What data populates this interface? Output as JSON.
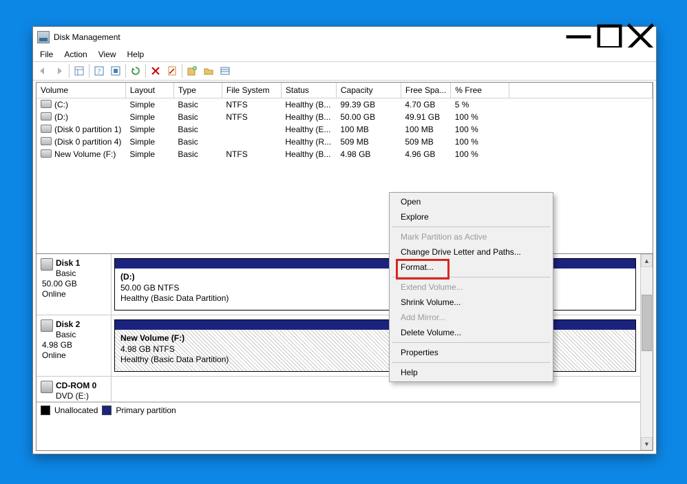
{
  "window": {
    "title": "Disk Management",
    "min_tooltip": "Minimize",
    "max_tooltip": "Maximize",
    "close_tooltip": "Close"
  },
  "menubar": [
    "File",
    "Action",
    "View",
    "Help"
  ],
  "volume_table": {
    "columns": [
      "Volume",
      "Layout",
      "Type",
      "File System",
      "Status",
      "Capacity",
      "Free Spa...",
      "% Free"
    ],
    "rows": [
      {
        "name": "(C:)",
        "layout": "Simple",
        "type": "Basic",
        "fs": "NTFS",
        "status": "Healthy (B...",
        "capacity": "99.39 GB",
        "free": "4.70 GB",
        "pct": "5 %"
      },
      {
        "name": "(D:)",
        "layout": "Simple",
        "type": "Basic",
        "fs": "NTFS",
        "status": "Healthy (B...",
        "capacity": "50.00 GB",
        "free": "49.91 GB",
        "pct": "100 %"
      },
      {
        "name": "(Disk 0 partition 1)",
        "layout": "Simple",
        "type": "Basic",
        "fs": "",
        "status": "Healthy (E...",
        "capacity": "100 MB",
        "free": "100 MB",
        "pct": "100 %"
      },
      {
        "name": "(Disk 0 partition 4)",
        "layout": "Simple",
        "type": "Basic",
        "fs": "",
        "status": "Healthy (R...",
        "capacity": "509 MB",
        "free": "509 MB",
        "pct": "100 %"
      },
      {
        "name": "New Volume (F:)",
        "layout": "Simple",
        "type": "Basic",
        "fs": "NTFS",
        "status": "Healthy (B...",
        "capacity": "4.98 GB",
        "free": "4.96 GB",
        "pct": "100 %"
      }
    ]
  },
  "disks": [
    {
      "label": "Disk 1",
      "sub1": "Basic",
      "sub2": "50.00 GB",
      "sub3": "Online",
      "part_title": "(D:)",
      "part_line1": "50.00 GB NTFS",
      "part_line2": "Healthy (Basic Data Partition)",
      "hatched": false
    },
    {
      "label": "Disk 2",
      "sub1": "Basic",
      "sub2": "4.98 GB",
      "sub3": "Online",
      "part_title": "New Volume  (F:)",
      "part_line1": "4.98 GB NTFS",
      "part_line2": "Healthy (Basic Data Partition)",
      "hatched": true
    },
    {
      "label": "CD-ROM 0",
      "sub1": "DVD (E:)",
      "sub2": "",
      "sub3": "",
      "part_title": "",
      "part_line1": "",
      "part_line2": "",
      "hatched": false,
      "no_part": true
    }
  ],
  "legend": {
    "unallocated": "Unallocated",
    "primary": "Primary partition"
  },
  "context_menu": {
    "items": [
      {
        "label": "Open",
        "disabled": false
      },
      {
        "label": "Explore",
        "disabled": false
      },
      {
        "sep": true
      },
      {
        "label": "Mark Partition as Active",
        "disabled": true
      },
      {
        "label": "Change Drive Letter and Paths...",
        "disabled": false
      },
      {
        "label": "Format...",
        "disabled": false,
        "highlight": true
      },
      {
        "sep": true
      },
      {
        "label": "Extend Volume...",
        "disabled": true
      },
      {
        "label": "Shrink Volume...",
        "disabled": false
      },
      {
        "label": "Add Mirror...",
        "disabled": true
      },
      {
        "label": "Delete Volume...",
        "disabled": false
      },
      {
        "sep": true
      },
      {
        "label": "Properties",
        "disabled": false
      },
      {
        "sep": true
      },
      {
        "label": "Help",
        "disabled": false
      }
    ]
  }
}
